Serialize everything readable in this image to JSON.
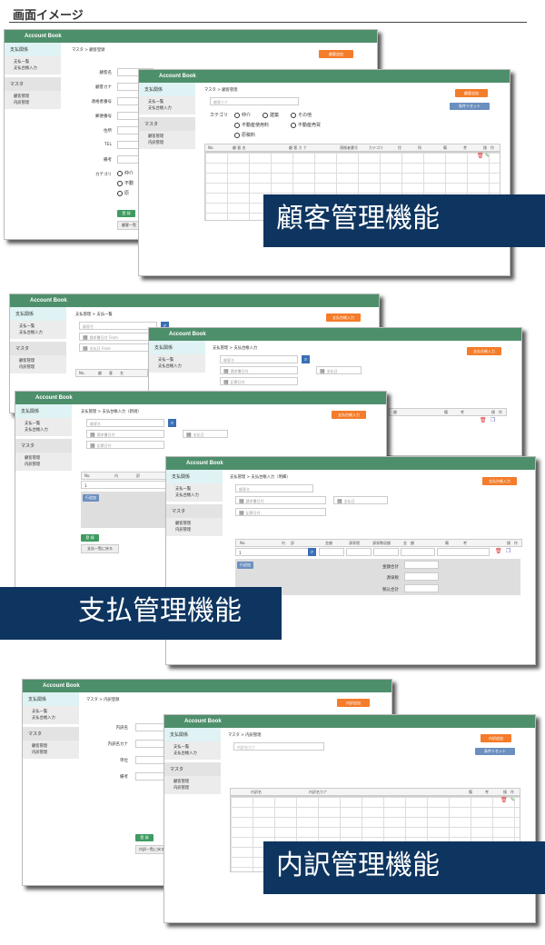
{
  "page": {
    "title": "画面イメージ"
  },
  "app": {
    "name": "Account Book"
  },
  "sidebar": {
    "sections": [
      {
        "label": "支払関係",
        "items": [
          "支払一覧",
          "支払台帳入力"
        ]
      },
      {
        "label": "マスタ",
        "items": [
          "顧客管理",
          "内訳管理"
        ]
      }
    ]
  },
  "customer": {
    "banner": "顧客管理機能",
    "back": {
      "breadcrumb": "マスタ > 顧客登録",
      "top_button": "顧客追加",
      "fields": [
        "顧客名",
        "顧客カナ",
        "適格者番号",
        "郵便番号",
        "住所",
        "TEL",
        "備考",
        "カテゴリ"
      ],
      "radio_partial": [
        "仲介",
        "不動",
        "業",
        "原"
      ],
      "register_button": "登 録",
      "back_button": "顧客一覧"
    },
    "front": {
      "breadcrumb": "マスタ > 顧客管理",
      "search_placeholder": "顧客カナ",
      "category_label": "カテゴリ",
      "radios": [
        "仲介",
        "建築",
        "その他",
        "不動産使用料",
        "不動産売買",
        "原稿料"
      ],
      "add_button": "顧客追加",
      "reset_button": "条件リセット",
      "columns": [
        "No.",
        "顧 客 名",
        "顧 客 カ ナ",
        "適格者番号",
        "カテゴリ",
        "住",
        "所",
        "備",
        "考",
        "操",
        "作"
      ]
    }
  },
  "payment": {
    "banner": "支払管理機能",
    "win1": {
      "breadcrumb": "支払管理 > 支払一覧",
      "add_button": "支払台帳入力",
      "search_placeholder": "顧客名",
      "date_from": "請求書日付 From",
      "date_from2": "支払日 From",
      "columns": [
        "No.",
        "顧",
        "客",
        "名"
      ]
    },
    "win2": {
      "breadcrumb": "支払管理 > 支払台帳入力",
      "add_button": "支払台帳入力",
      "search_placeholder": "顧客名",
      "invoice_date": "請求書日付",
      "pay_date": "支払日",
      "entry_date": "記票日付",
      "columns": [
        "額",
        "備",
        "考",
        "操",
        "作"
      ]
    },
    "win3": {
      "breadcrumb": "支払管理 > 支払台帳入力（新規）",
      "add_button": "支払台帳入力",
      "search_placeholder": "顧客名",
      "invoice_date": "請求書日付",
      "pay_date": "支払日",
      "entry_date": "記票日付",
      "columns": [
        "No.",
        "内",
        "訳"
      ],
      "row_no": "1",
      "add_row": "行追加",
      "register_button": "登 録",
      "back_button": "支払一覧に戻る"
    },
    "win4": {
      "breadcrumb": "支払管理 > 支払台帳入力（明細）",
      "add_button": "支払台帳入力",
      "search_placeholder": "顧客名",
      "invoice_date": "請求書日付",
      "pay_date": "支払日",
      "entry_date": "記票日付",
      "columns": [
        "No.",
        "内",
        "訳",
        "金額",
        "源泉税",
        "源泉徴収額",
        "金",
        "額",
        "備",
        "考",
        "操",
        "作"
      ],
      "row_no": "1",
      "add_row": "行追加",
      "totals": [
        "金額合計",
        "源泉税",
        "税込合計"
      ]
    }
  },
  "breakdown": {
    "banner": "内訳管理機能",
    "back": {
      "breadcrumb": "マスタ > 内訳登録",
      "top_button": "内訳追加",
      "fields": [
        "内訳名",
        "内訳名カナ",
        "単位",
        "備考"
      ],
      "register_button": "登 録",
      "back_button": "内訳一覧に戻る"
    },
    "front": {
      "breadcrumb": "マスタ > 内訳管理",
      "search_placeholder": "内訳名カナ",
      "add_button": "内訳追加",
      "reset_button": "条件リセット",
      "columns": [
        "内訳名",
        "内訳名カナ",
        "備",
        "考",
        "操",
        "作"
      ]
    }
  },
  "colors": {
    "header": "#4e8f6b",
    "accent": "#f47c2a",
    "banner": "#0e3560",
    "sidebar_active": "#dff3f4"
  }
}
